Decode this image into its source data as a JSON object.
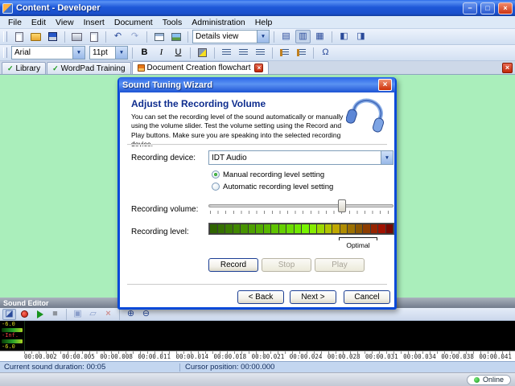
{
  "glyphs": {
    "dropdown": "▼",
    "close": "×",
    "check": "✓",
    "minimize": "−",
    "maximize": "□"
  },
  "window": {
    "title": "Content - Developer"
  },
  "menubar": {
    "items": [
      "File",
      "Edit",
      "View",
      "Insert",
      "Document",
      "Tools",
      "Administration",
      "Help"
    ]
  },
  "toolbar_main": {
    "details_view": "Details view",
    "left_icons": [
      {
        "name": "new-document",
        "cls": "ic-doc"
      },
      {
        "name": "open-folder",
        "cls": "ic-folder"
      },
      {
        "name": "save",
        "cls": "ic-save"
      },
      {
        "sep": true
      },
      {
        "name": "print",
        "cls": "ic-print"
      },
      {
        "name": "print-preview",
        "cls": "ic-doc"
      },
      {
        "sep": true
      },
      {
        "name": "undo",
        "glyph": "↶",
        "cls": "ic-glyph"
      },
      {
        "name": "redo",
        "glyph": "↷",
        "cls": "ic-glyph",
        "disabled": true
      },
      {
        "sep": true
      },
      {
        "name": "insert-table",
        "cls": "ic-grid"
      },
      {
        "name": "insert-image",
        "cls": "ic-img"
      },
      {
        "sep": true
      }
    ],
    "right_icons": [
      {
        "sep": true
      },
      {
        "name": "view-list",
        "glyph": "▤",
        "cls": "ic-glyph"
      },
      {
        "name": "view-details",
        "glyph": "▥",
        "cls": "ic-glyph",
        "pressed": true
      },
      {
        "name": "view-thumbnails",
        "glyph": "▦",
        "cls": "ic-glyph"
      },
      {
        "sep": true
      },
      {
        "name": "split-view",
        "glyph": "◧",
        "cls": "ic-glyph"
      },
      {
        "name": "full-screen",
        "glyph": "◨",
        "cls": "ic-glyph"
      }
    ]
  },
  "toolbar_format": {
    "font": "Arial",
    "size": "11pt",
    "icons": [
      {
        "sep": true
      },
      {
        "name": "bold",
        "glyph": "B",
        "cls": "fmt-b"
      },
      {
        "name": "italic",
        "glyph": "I",
        "cls": "fmt-i"
      },
      {
        "name": "underline",
        "glyph": "U",
        "cls": "fmt-u"
      },
      {
        "sep": true
      },
      {
        "name": "highlight",
        "cls": "ic-hl"
      },
      {
        "sep": true
      },
      {
        "name": "align-left",
        "cls": "ic-al"
      },
      {
        "name": "align-center",
        "cls": "ic-al"
      },
      {
        "name": "align-right",
        "cls": "ic-al"
      },
      {
        "sep": true
      },
      {
        "name": "numbered-list",
        "cls": "ic-li"
      },
      {
        "name": "bullet-list",
        "cls": "ic-li"
      },
      {
        "sep": true
      },
      {
        "name": "insert-symbol",
        "glyph": "Ω",
        "cls": "ic-glyph"
      }
    ]
  },
  "tabbar": {
    "tabs": [
      {
        "label": "Library",
        "active": false
      },
      {
        "label": "WordPad Training",
        "active": false
      },
      {
        "label": "Document Creation flowchart",
        "active": true,
        "closable": true
      }
    ]
  },
  "dialog": {
    "title": "Sound Tuning Wizard",
    "heading": "Adjust the Recording Volume",
    "description": "You can set the recording level of the sound automatically or manually using the volume slider. Test the volume setting using the Record and Play buttons. Make sure you are speaking into the selected recording device.",
    "device_label": "Recording device:",
    "device_value": "IDT Audio",
    "radios": [
      {
        "label": "Manual recording level setting",
        "selected": true
      },
      {
        "label": "Automatic recording level setting",
        "selected": false
      }
    ],
    "volume_label": "Recording volume:",
    "volume_percent": 72,
    "level_label": "Recording level:",
    "optimal_label": "Optimal",
    "level_meter_colors": [
      "#2f6400",
      "#357000",
      "#3b7c00",
      "#418800",
      "#479400",
      "#4da000",
      "#53ac00",
      "#59b800",
      "#5fc400",
      "#65d000",
      "#6bdc00",
      "#71e800",
      "#77f400",
      "#86ec00",
      "#9cd800",
      "#b2c400",
      "#c0a800",
      "#b08c00",
      "#9c7000",
      "#8a5600",
      "#8c3c00",
      "#962400",
      "#a01200",
      "#7a0800"
    ],
    "record_button": "Record",
    "stop_button": "Stop",
    "play_button": "Play",
    "back_button": "< Back",
    "next_button": "Next >",
    "cancel_button": "Cancel"
  },
  "sound_editor": {
    "title": "Sound Editor",
    "toolbar_icons": [
      {
        "name": "dock-panel",
        "glyph": "◪",
        "cls": "ic-glyph",
        "pressed": true
      },
      {
        "name": "record-sound",
        "cls": "ic-rec"
      },
      {
        "name": "play-sound",
        "cls": "ic-play"
      },
      {
        "name": "stop-sound",
        "glyph": "■",
        "cls": "ic-glyph ic-stop",
        "disabled": true
      },
      {
        "sep": true
      },
      {
        "name": "save-sound",
        "glyph": "▣",
        "cls": "ic-glyph",
        "disabled": true
      },
      {
        "name": "copy-sound",
        "glyph": "▱",
        "cls": "ic-glyph",
        "disabled": true
      },
      {
        "name": "delete-sound",
        "glyph": "×",
        "cls": "ic-glyph ic-del",
        "disabled": true
      },
      {
        "sep": true
      },
      {
        "name": "zoom-in",
        "glyph": "⊕",
        "cls": "ic-glyph"
      },
      {
        "name": "zoom-out",
        "glyph": "⊖",
        "cls": "ic-glyph"
      }
    ],
    "meter_labels": [
      "-6.0",
      "-Inf.",
      "-6.0"
    ],
    "timeline": [
      "00:00.002",
      "00:00.005",
      "00:00.008",
      "00:00.011",
      "00:00.014",
      "00:00.018",
      "00:00.021",
      "00:00.024",
      "00:00.028",
      "00:00.031",
      "00:00.034",
      "00:00.038",
      "00:00.041"
    ]
  },
  "status_bar": {
    "duration": "Current sound duration: 00:05",
    "cursor": "Cursor position: 00:00.000"
  },
  "bottom_bar": {
    "online": "Online"
  }
}
